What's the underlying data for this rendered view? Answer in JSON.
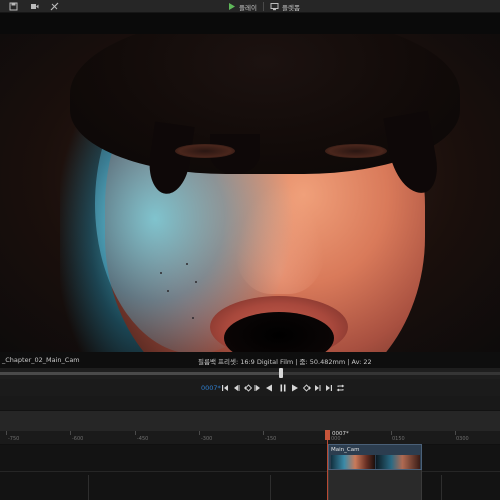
{
  "toolbar": {
    "play_label": "플레이",
    "render_label": "플렛폼"
  },
  "viewport": {
    "shot_name": "_Chapter_02_Main_Cam",
    "camera_info": "필름백 프리셋: 16:9 Digital Film | 줌: 50.482mm | Av: 22"
  },
  "transport": {
    "current_frame": "0007*"
  },
  "timeline": {
    "playhead_label": "0007*",
    "ruler_labels": [
      "-750",
      "-600",
      "-450",
      "-300",
      "-150",
      "000",
      "0150",
      "0300"
    ],
    "clip_name": "Main_Cam"
  },
  "colors": {
    "accent_blue": "#2f7fd0",
    "playhead": "#c8553a",
    "clip": "#2c3d4f"
  },
  "icons": {
    "toolbar": [
      "save-icon",
      "camera-icon",
      "transform-icon",
      "play-icon",
      "render-icon"
    ],
    "transport": [
      "jump-start-icon",
      "prev-key-icon",
      "add-key-icon",
      "next-key-icon",
      "step-back-icon",
      "play-reverse-icon",
      "pause-icon",
      "play-forward-icon",
      "step-forward-icon",
      "jump-end-icon",
      "loop-icon"
    ]
  }
}
